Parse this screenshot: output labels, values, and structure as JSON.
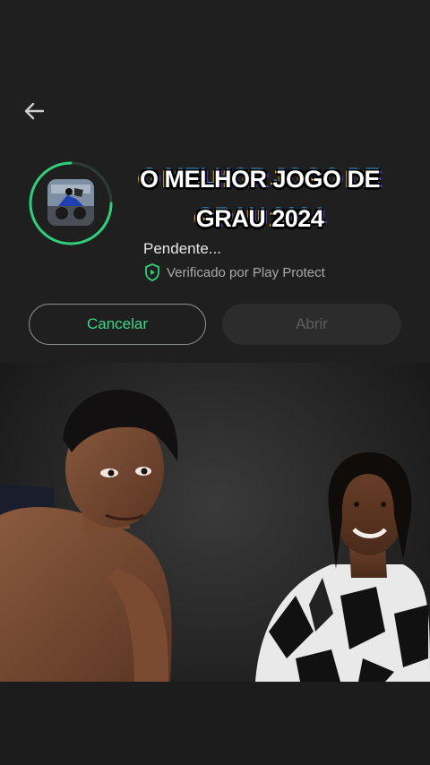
{
  "overlay": {
    "title_line1": "O MELHOR JOGO DE",
    "title_line2": "GRAU 2024"
  },
  "install": {
    "status": "Pendente...",
    "verified": "Verificado por Play Protect",
    "cancel_label": "Cancelar",
    "open_label": "Abrir"
  },
  "icons": {
    "back": "arrow-back-icon",
    "shield": "shield-check-icon"
  },
  "colors": {
    "accent_green": "#39d98a",
    "background": "#1f1f1f"
  }
}
